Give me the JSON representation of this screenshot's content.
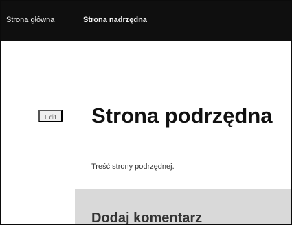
{
  "nav": {
    "home_label": "Strona główna",
    "parent_label": "Strona nadrzędna"
  },
  "page": {
    "edit_label": "Edit",
    "title": "Strona podrzędna",
    "content": "Treść strony podrzędnej."
  },
  "comments": {
    "heading": "Dodaj komentarz"
  },
  "colors": {
    "topbar": "#0f0f0f",
    "nav_text": "#f2f2f2",
    "edit_background": "#efefef",
    "comment_panel": "#d9d9d9",
    "title_text": "#111111",
    "body_text": "#333333"
  }
}
